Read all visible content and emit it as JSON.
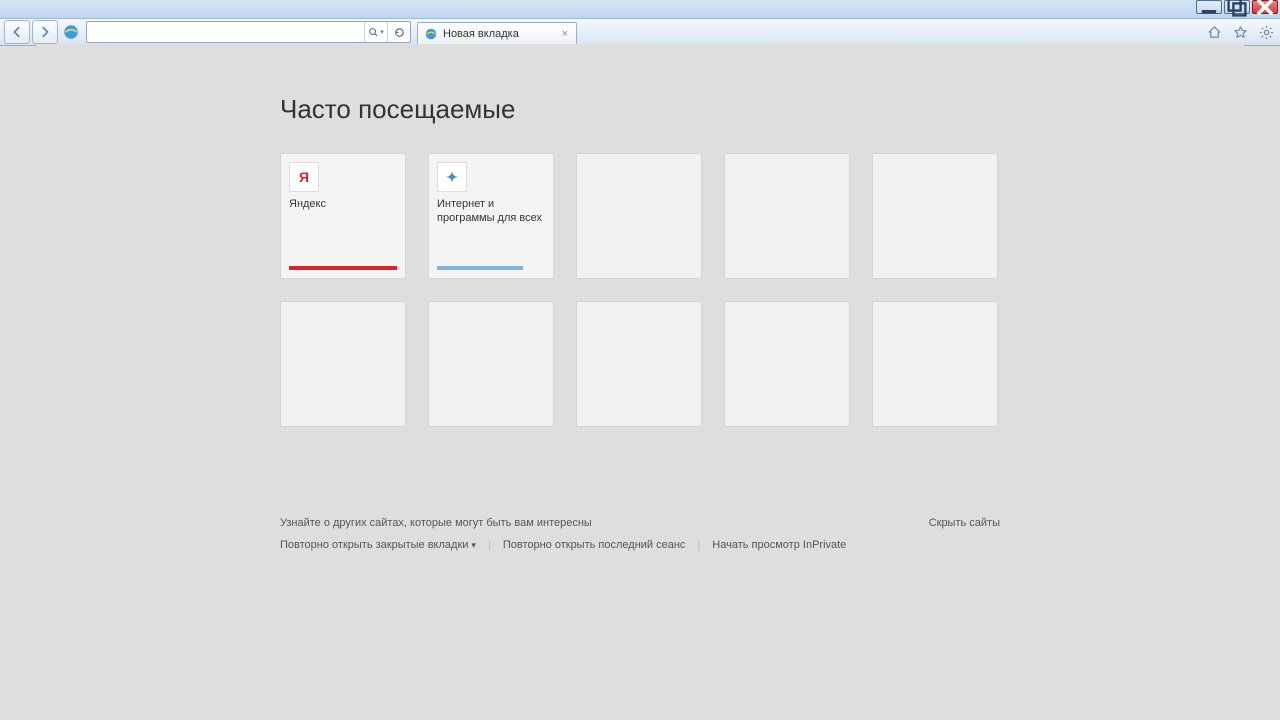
{
  "window": {
    "tab_title": "Новая вкладка"
  },
  "toolbar": {
    "address_value": "",
    "search_tooltip": "Поиск",
    "refresh_tooltip": "Обновить"
  },
  "ntp": {
    "heading": "Часто посещаемые",
    "tiles": [
      {
        "title": "Яндекс",
        "icon_text": "Я",
        "icon_color": "#d8232a",
        "bar_color": "#d8232a"
      },
      {
        "title": "Интернет и программы для всех",
        "icon_text": "✦",
        "icon_color": "#4f8acb",
        "bar_color": "#7fb5e4"
      },
      {
        "title": "",
        "empty": true
      },
      {
        "title": "",
        "empty": true
      },
      {
        "title": "",
        "empty": true
      },
      {
        "title": "",
        "empty": true
      },
      {
        "title": "",
        "empty": true
      },
      {
        "title": "",
        "empty": true
      },
      {
        "title": "",
        "empty": true
      },
      {
        "title": "",
        "empty": true
      }
    ],
    "discover_text": "Узнайте о других сайтах, которые могут быть вам интересны",
    "hide_sites": "Скрыть сайты",
    "reopen_closed": "Повторно открыть закрытые вкладки",
    "reopen_last": "Повторно открыть последний сеанс",
    "inprivate": "Начать просмотр InPrivate"
  }
}
